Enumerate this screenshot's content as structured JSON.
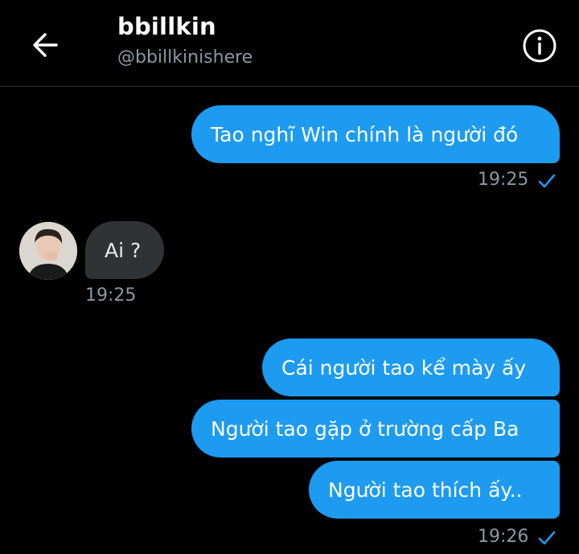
{
  "header": {
    "title": "bbillkin",
    "handle": "@bbillkinishere",
    "back_icon": "arrow-left-icon",
    "info_icon": "info-circle-icon"
  },
  "messages": [
    {
      "direction": "sent",
      "text": "Tao nghĩ Win chính là người đó"
    },
    {
      "direction": "received",
      "text": "Ai ?"
    },
    {
      "direction": "sent",
      "text": "Cái người tao kể mày ấy"
    },
    {
      "direction": "sent",
      "text": "Người tao gặp ở trường cấp Ba"
    },
    {
      "direction": "sent",
      "text": "Người tao thích ấy.."
    }
  ],
  "timestamps": {
    "group1": "19:25",
    "group2": "19:25",
    "group3": "19:26"
  },
  "colors": {
    "sent_bubble": "#1d9bf0",
    "received_bubble": "#2f3336",
    "background": "#000000",
    "muted_text": "#8b98a5",
    "check": "#1d9bf0"
  }
}
